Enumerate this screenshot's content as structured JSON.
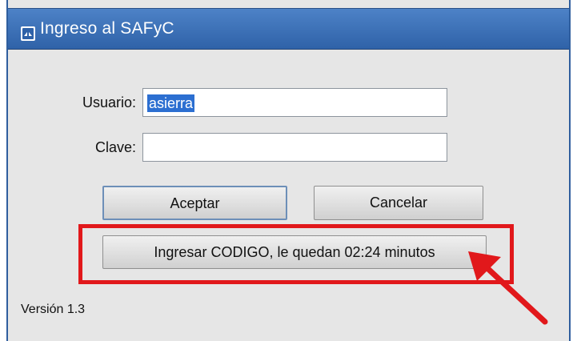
{
  "window": {
    "title": "Ingreso al SAFyC",
    "title_icon": "java-applet-icon"
  },
  "form": {
    "user_label": "Usuario:",
    "user_value": "asierra",
    "password_label": "Clave:",
    "password_value": ""
  },
  "buttons": {
    "accept": "Aceptar",
    "cancel": "Cancelar",
    "code": "Ingresar CODIGO, le quedan 02:24 minutos"
  },
  "footer": {
    "version": "Versión 1.3"
  },
  "annotation": {
    "highlight_color": "#e1181b",
    "arrow_color": "#e1181b"
  },
  "colors": {
    "titlebar": "#2f62a8",
    "selection": "#2c6fd1",
    "window_bg": "#e6e6e6"
  }
}
